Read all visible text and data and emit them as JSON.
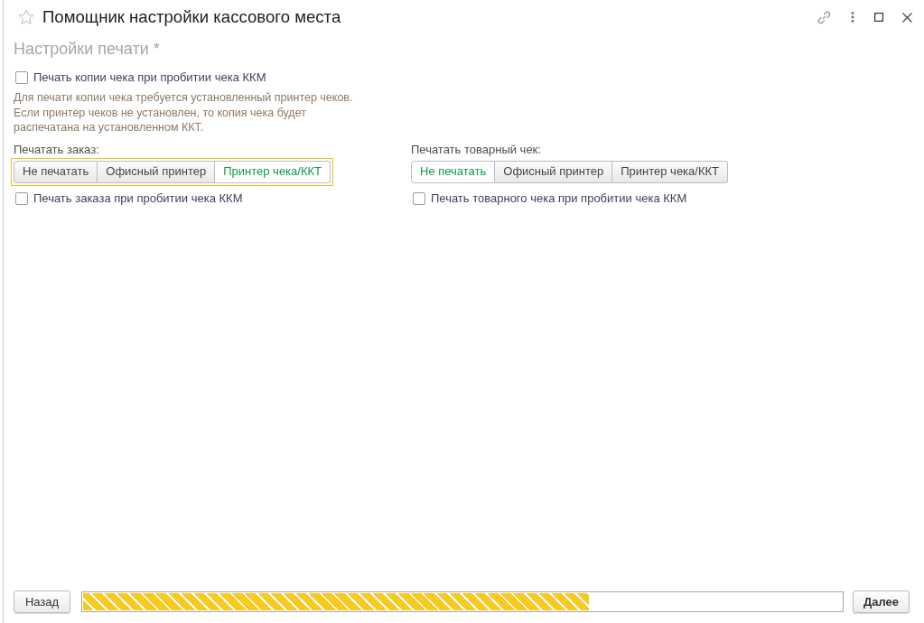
{
  "window": {
    "title": "Помощник настройки кассового места"
  },
  "section_title": "Настройки печати *",
  "print_copy": {
    "label": "Печать копии чека при пробитии чека ККМ",
    "checked": false
  },
  "hint": "Для печати копии чека требуется установленный принтер чеков. Если принтер чеков не установлен, то копия чека будет распечатана на установленном ККТ.",
  "print_groups": [
    {
      "label": "Печатать заказ:",
      "focused": true,
      "options": [
        {
          "label": "Не печатать",
          "selected": false
        },
        {
          "label": "Офисный принтер",
          "selected": false
        },
        {
          "label": "Принтер чека/ККТ",
          "selected": true
        }
      ],
      "checkbox": {
        "label": "Печать заказа при пробитии чека ККМ",
        "checked": false
      }
    },
    {
      "label": "Печатать товарный чек:",
      "focused": false,
      "options": [
        {
          "label": "Не печатать",
          "selected": true
        },
        {
          "label": "Офисный принтер",
          "selected": false
        },
        {
          "label": "Принтер чека/ККТ",
          "selected": false
        }
      ],
      "checkbox": {
        "label": "Печать товарного чека при пробитии чека ККМ",
        "checked": false
      }
    }
  ],
  "footer": {
    "back_button": "Назад",
    "progress": {
      "level": 0.667
    },
    "next_button": "Далее"
  }
}
